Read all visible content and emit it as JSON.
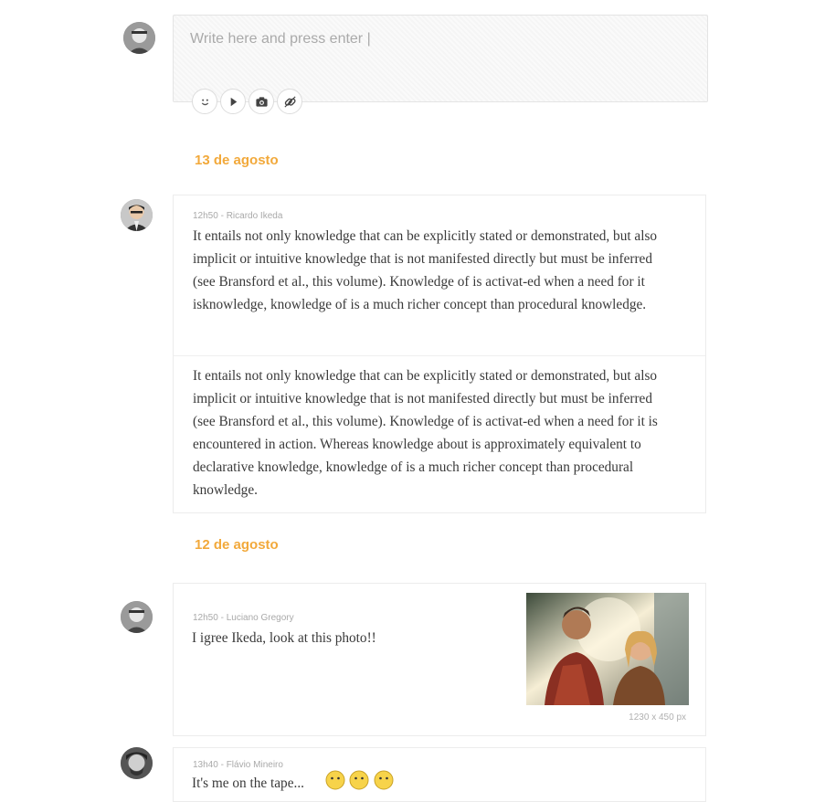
{
  "composer": {
    "placeholder": "Write here and press enter |",
    "tools": [
      "emoji-icon",
      "play-icon",
      "camera-icon",
      "link-icon"
    ]
  },
  "groups": [
    {
      "date": "13 de agosto",
      "post": {
        "meta": "12h50 - Ricardo Ikeda",
        "paragraphs": [
          "It entails not only knowledge that can be explicitly stated or demonstrated, but also implicit or intuitive knowledge that is not manifested directly but must be inferred (see Bransford et al., this volume). Knowledge of is activat-ed when a need for it isknowledge, knowledge of is a much richer concept than procedural knowledge.",
          "It entails not only knowledge that can be explicitly stated or demonstrated, but also implicit or intuitive knowledge that is not manifested directly but must be inferred (see Bransford et al., this volume). Knowledge of is activat-ed when a need for it is encountered in action. Whereas knowledge about is approximately equivalent to declarative knowledge, knowledge of is a much richer concept than procedural knowledge."
        ]
      }
    },
    {
      "date": "12 de agosto",
      "post": {
        "meta": "12h50 - Luciano Gregory",
        "text": "I igree Ikeda, look at this photo!!",
        "image_dims": "1230 x 450 px"
      }
    }
  ],
  "partial_post": {
    "meta": "13h40 - Flávio Mineiro",
    "text": "It's me on the tape..."
  },
  "colors": {
    "accent": "#f2a93b",
    "meta": "#a9a9a9",
    "body": "#3a3a3a"
  }
}
